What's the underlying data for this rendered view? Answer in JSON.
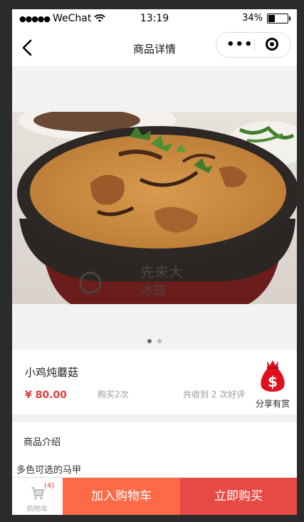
{
  "status_bar": {
    "signal": "●●●●●",
    "carrier": "WeChat",
    "time": "13:19",
    "battery_percent_label": "34%",
    "battery_level": 0.34
  },
  "nav": {
    "title": "商品详情"
  },
  "gallery": {
    "image_count": 2,
    "active_index": 0
  },
  "product": {
    "name": "小鸡炖蘑菇",
    "price": "¥ 80.00",
    "purchases": "购买2次",
    "reviews": "共收到 2 次好评"
  },
  "share": {
    "label": "分享有赏",
    "icon": "money-bag-icon"
  },
  "intro": {
    "title": "商品介绍",
    "text": "多色可选的马甲"
  },
  "bottom_bar": {
    "cart_label": "购物车",
    "cart_count": "(4)",
    "add_to_cart": "加入购物车",
    "buy_now": "立即购买"
  },
  "colors": {
    "price_red": "#e4393c",
    "add_cart_orange": "#fe6a46",
    "buy_now_red": "#e74a45",
    "background_gray": "#f2f2f2"
  }
}
